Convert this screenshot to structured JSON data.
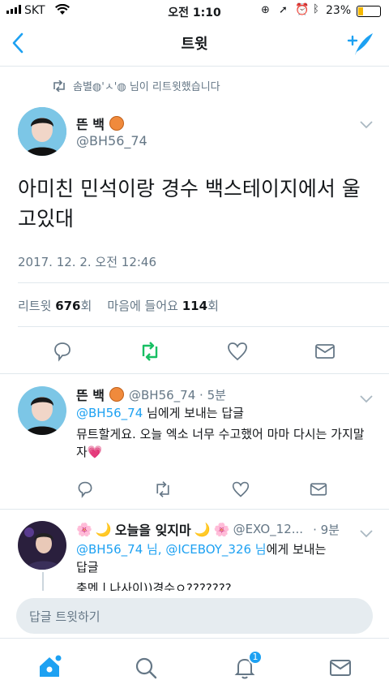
{
  "status": {
    "carrier": "SKT",
    "time": "오전 1:10",
    "battery": "23%"
  },
  "nav": {
    "title": "트윗"
  },
  "retweet_notice": "솜별◍'ㅅ'◍ 님이 리트윗했습니다",
  "main_tweet": {
    "name": "뜬 백",
    "handle": "@BH56_74",
    "text": "아미친 민석이랑 경수 백스테이지에서 울고있대",
    "timestamp": "2017. 12. 2. 오전 12:46",
    "retweet_label": "리트윗",
    "retweet_count": "676",
    "count_suffix": "회",
    "like_label": "마음에 들어요",
    "like_count": "114"
  },
  "reply1": {
    "name": "뜬 백",
    "handle_time": "@BH56_74 · 5분",
    "reply_to_handle": "@BH56_74",
    "reply_to_suffix": " 님에게 보내는 답글",
    "text": "뮤트할게요. 오늘 엑소 너무 수고했어 마마 다시는 가지말자"
  },
  "reply2": {
    "name": "오늘을 잊지마",
    "handle": "@EXO_12...",
    "time": "· 9분",
    "reply_to_handle": "@BH56_74 님, @ICEBOY_326 님",
    "reply_to_suffix": "에게 보내는",
    "reply_to_suffix2": "답글",
    "text": "충멘ㅣ나사이))경수ㅇ???????"
  },
  "compose": {
    "placeholder": "답글 트윗하기"
  },
  "tabbar": {
    "notification_badge": "1"
  },
  "colors": {
    "accent": "#1da1f2",
    "retweet_green": "#17bf63",
    "gray": "#657786",
    "heart_pink": "#e0245e"
  }
}
